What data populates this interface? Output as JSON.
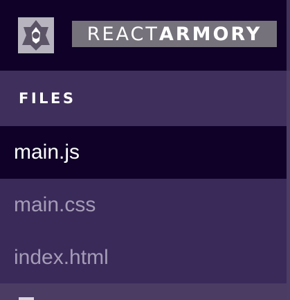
{
  "brand": {
    "logo_icon": "react-armory-logo-icon",
    "wordmark_light": "REACT",
    "wordmark_bold": "ARMORY"
  },
  "files": {
    "header": "FILES",
    "items": [
      {
        "label": "main.js",
        "active": true
      },
      {
        "label": "main.css",
        "active": false
      },
      {
        "label": "index.html",
        "active": false
      }
    ]
  },
  "colors": {
    "brand_bg": "#0f0128",
    "sidebar_bg": "#3a2a5a",
    "header_bg": "#3f2f5c",
    "active_item_bg": "#0f0128",
    "inactive_text": "#a59cb6"
  }
}
